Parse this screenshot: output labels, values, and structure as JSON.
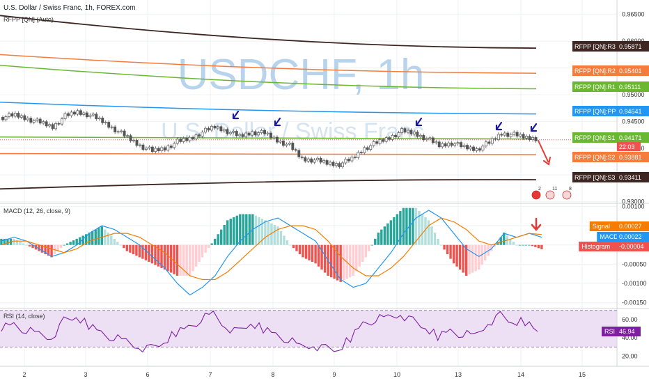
{
  "header": {
    "symbol_title": "U.S. Dollar / Swiss Franc, 1h, FOREX.com",
    "indicator_label": "RFPP [QN] (Auto)",
    "watermark_main": "USDCHF, 1h",
    "watermark_sub": "U.S. Dollar / Swiss Franc"
  },
  "price_axis": {
    "ticks": [
      "0.96500",
      "0.96000",
      "0.95500",
      "0.95000",
      "0.94500",
      "0.94000",
      "0.93500",
      "0.93000"
    ],
    "tick_values": [
      0.965,
      0.96,
      0.955,
      0.95,
      0.945,
      0.94,
      0.935,
      0.93
    ],
    "range": [
      0.9297,
      0.9677
    ]
  },
  "pivot_tags": [
    {
      "label": "RFPP [QN]:R3",
      "value": "0.95871",
      "color": "#3e2723"
    },
    {
      "label": "RFPP [QN]:R2",
      "value": "0.95401",
      "color": "#f57c3b"
    },
    {
      "label": "RFPP [QN]:R1",
      "value": "0.95111",
      "color": "#6ab732"
    },
    {
      "label": "RFPP [QN]:PP",
      "value": "0.94641",
      "color": "#2196f3"
    },
    {
      "label": "RFPP [QN]:S1",
      "value": "0.94171",
      "color": "#6ab732"
    },
    {
      "label": "RFPP [QN]:S2",
      "value": "0.93881",
      "color": "#f57c3b"
    },
    {
      "label": "RFPP [QN]:S3",
      "value": "0.93411",
      "color": "#3e2723"
    }
  ],
  "countdown_tag": {
    "text": "22:03",
    "color": "#ef5350"
  },
  "macd": {
    "label": "MACD (12, 26, close, 9)",
    "ticks": [
      "0.00100",
      "0.00050",
      "0.00000",
      "-0.00050",
      "-0.00100",
      "-0.00150"
    ],
    "tick_values": [
      0.001,
      0.0005,
      0,
      -0.0005,
      -0.001,
      -0.0015
    ],
    "range": [
      -0.00165,
      0.00108
    ],
    "tags": [
      {
        "label": "Signal",
        "value": "0.00027",
        "color": "#f57c00"
      },
      {
        "label": "MACD",
        "value": "0.00022",
        "color": "#2196f3"
      },
      {
        "label": "Histogram",
        "value": "-0.00004",
        "color": "#ef5350"
      }
    ]
  },
  "rsi": {
    "label": "RSI (14, close)",
    "ticks": [
      "60.00",
      "40.00",
      "20.00"
    ],
    "tick_values": [
      60,
      40,
      20
    ],
    "range": [
      9,
      72
    ],
    "band": [
      30,
      70
    ],
    "tag": {
      "label": "RSI",
      "value": "46.94",
      "color": "#7e1fa2"
    }
  },
  "time_axis": {
    "labels": [
      "2",
      "3",
      "6",
      "7",
      "8",
      "9",
      "10",
      "13",
      "14",
      "15"
    ]
  },
  "colors": {
    "up": "#26a69a",
    "down": "#ef5350",
    "candle": "#555555",
    "pp": "#2196f3",
    "r1s1": "#6ab732",
    "r2s2": "#f57c3b",
    "r3s3": "#3e2723",
    "macd_line": "#2196f3",
    "signal_line": "#f57c00",
    "rsi_line": "#7e1fa2",
    "rsi_fill": "#ede0f5",
    "annotation_arrow": "#1a1aa0",
    "forecast_arrow": "#e53935",
    "grid": "#eef0f3"
  },
  "event_icons": [
    {
      "label": "2"
    },
    {
      "label": "11"
    },
    {
      "label": "8"
    }
  ],
  "chart_data": {
    "type": "line",
    "subtype": "candlestick-with-pivots",
    "x_categories": [
      "2",
      "3",
      "6",
      "7",
      "8",
      "9",
      "10",
      "13",
      "14",
      "15"
    ],
    "price_series": {
      "name": "USDCHF close",
      "values": [
        0.9458,
        0.9462,
        0.9455,
        0.9448,
        0.944,
        0.946,
        0.9468,
        0.9462,
        0.945,
        0.9435,
        0.942,
        0.9405,
        0.9395,
        0.94,
        0.9412,
        0.9418,
        0.943,
        0.944,
        0.9432,
        0.9422,
        0.943,
        0.9428,
        0.9415,
        0.9405,
        0.938,
        0.9378,
        0.9372,
        0.937,
        0.938,
        0.94,
        0.941,
        0.942,
        0.9432,
        0.9428,
        0.9418,
        0.9405,
        0.941,
        0.9402,
        0.9398,
        0.941,
        0.9428,
        0.9425,
        0.942,
        0.9418
      ]
    },
    "pivot_levels": [
      {
        "name": "RFPP [QN]:R3",
        "start": 0.9648,
        "end": 0.95871
      },
      {
        "name": "RFPP [QN]:R2",
        "start": 0.9575,
        "end": 0.95401
      },
      {
        "name": "RFPP [QN]:R1",
        "start": 0.9555,
        "end": 0.95111
      },
      {
        "name": "RFPP [QN]:PP",
        "start": 0.9486,
        "end": 0.94641
      },
      {
        "name": "RFPP [QN]:S1",
        "start": 0.9421,
        "end": 0.94171
      },
      {
        "name": "RFPP [QN]:S2",
        "start": 0.939,
        "end": 0.93881
      },
      {
        "name": "RFPP [QN]:S3",
        "start": 0.9324,
        "end": 0.93411
      }
    ],
    "macd_series": [
      0.0001,
      0.0002,
      0.0001,
      -0.0001,
      -0.0003,
      -0.0002,
      0.0,
      0.0003,
      0.0005,
      0.0004,
      0.0002,
      0.0,
      -0.0003,
      -0.0006,
      -0.001,
      -0.0013,
      -0.0011,
      -0.0008,
      -0.0003,
      0.0001,
      0.0004,
      0.0006,
      0.0007,
      0.0005,
      0.0003,
      0.0001,
      -0.0004,
      -0.0009,
      -0.0011,
      -0.001,
      -0.0006,
      -0.0002,
      0.0003,
      0.0007,
      0.0009,
      0.0007,
      0.0003,
      -0.0001,
      -0.0003,
      -0.0001,
      0.0003,
      0.0002,
      0.0003,
      0.0002
    ],
    "signal_series": [
      0.0,
      0.0001,
      0.0001,
      0.0,
      -0.0001,
      -0.0002,
      -0.0001,
      0.0001,
      0.0002,
      0.0003,
      0.0003,
      0.0002,
      0.0,
      -0.0002,
      -0.0005,
      -0.0008,
      -0.0009,
      -0.0009,
      -0.0007,
      -0.0004,
      -0.0001,
      0.0002,
      0.0004,
      0.0005,
      0.0005,
      0.0004,
      0.0001,
      -0.0003,
      -0.0006,
      -0.0008,
      -0.0008,
      -0.0006,
      -0.0003,
      0.0001,
      0.0005,
      0.0007,
      0.0006,
      0.0004,
      0.0001,
      0.0,
      0.0001,
      0.0002,
      0.0003,
      0.00027
    ],
    "rsi_series": [
      52,
      55,
      48,
      44,
      40,
      58,
      62,
      54,
      46,
      40,
      36,
      30,
      28,
      34,
      46,
      52,
      60,
      66,
      52,
      46,
      55,
      50,
      44,
      38,
      30,
      32,
      28,
      26,
      40,
      56,
      60,
      62,
      66,
      58,
      50,
      42,
      48,
      44,
      42,
      56,
      64,
      56,
      58,
      46.94
    ],
    "rsi_bands": [
      30,
      70
    ],
    "ylim_price": [
      0.9297,
      0.9677
    ],
    "ylim_macd": [
      -0.00165,
      0.00108
    ],
    "ylim_rsi": [
      9,
      72
    ],
    "grid": true
  }
}
